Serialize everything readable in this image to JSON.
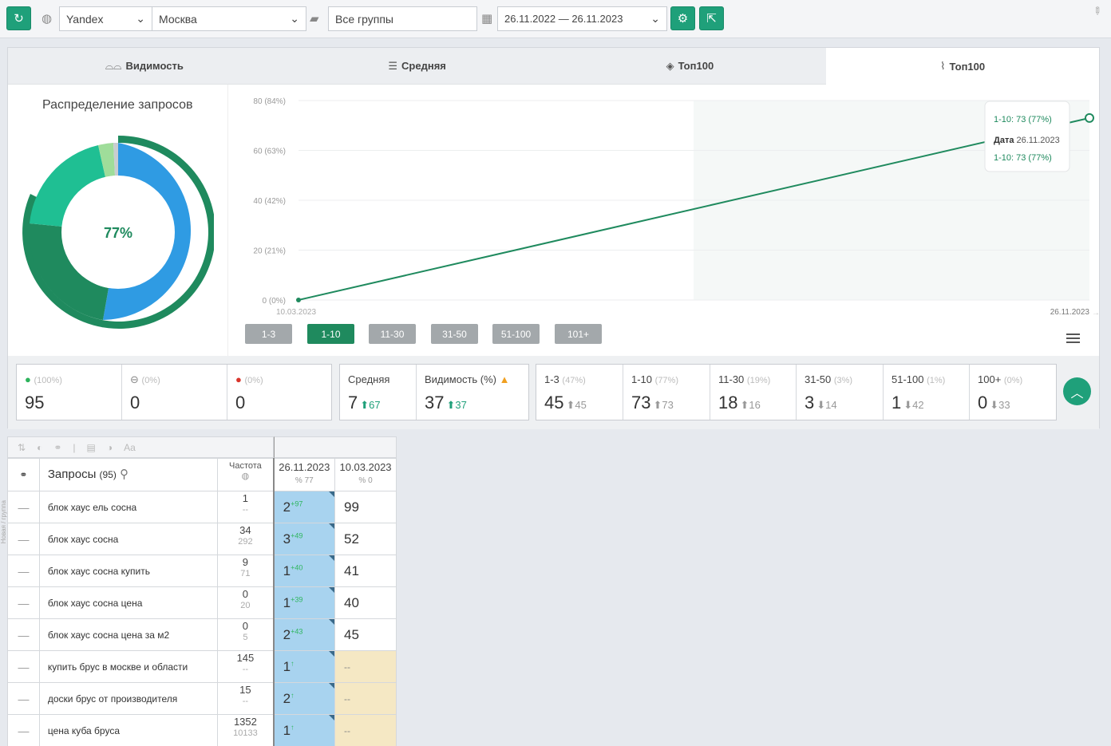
{
  "toolbar": {
    "search_engine": "Yandex",
    "region": "Москва",
    "group": "Все группы",
    "date_range": "26.11.2022 — 26.11.2023"
  },
  "tabs": [
    {
      "icon": "glasses-icon",
      "label": "Видимость"
    },
    {
      "icon": "list-icon",
      "label": "Средняя"
    },
    {
      "icon": "layers-icon",
      "label": "Топ100"
    },
    {
      "icon": "chart-icon",
      "label": "Топ100"
    }
  ],
  "distribution": {
    "title": "Распределение запросов",
    "center_value": "77%"
  },
  "chart_data": {
    "type": "line",
    "y_ticks": [
      "80 (84%)",
      "60 (63%)",
      "40 (42%)",
      "20 (21%)",
      "0 (0%)"
    ],
    "ylim": [
      0,
      80
    ],
    "x_start": "10.03.2023",
    "x_end": "26.11.2023",
    "series": [
      {
        "name": "1-10",
        "values": [
          0,
          73
        ],
        "x": [
          "10.03.2023",
          "26.11.2023"
        ]
      }
    ],
    "tooltip": {
      "line1": "1-10: 73 (77%)",
      "date_label": "Дата",
      "date": "26.11.2023",
      "line2": "1-10: 73 (77%)"
    }
  },
  "range_buttons": [
    "1-3",
    "1-10",
    "11-30",
    "31-50",
    "51-100",
    "101+"
  ],
  "stats": {
    "up": {
      "pct": "(100%)",
      "value": "95"
    },
    "eq": {
      "pct": "(0%)",
      "value": "0"
    },
    "down": {
      "pct": "(0%)",
      "value": "0"
    },
    "avg": {
      "label": "Средняя",
      "value": "7",
      "delta": "67"
    },
    "vis": {
      "label": "Видимость (%)",
      "value": "37",
      "delta": "37"
    },
    "ranges": [
      {
        "label": "1-3",
        "pct": "(47%)",
        "value": "45",
        "delta": "45"
      },
      {
        "label": "1-10",
        "pct": "(77%)",
        "value": "73",
        "delta": "73"
      },
      {
        "label": "11-30",
        "pct": "(19%)",
        "value": "18",
        "delta": "16"
      },
      {
        "label": "31-50",
        "pct": "(3%)",
        "value": "3",
        "delta": "14"
      },
      {
        "label": "51-100",
        "pct": "(1%)",
        "value": "1",
        "delta": "42"
      },
      {
        "label": "100+",
        "pct": "(0%)",
        "value": "0",
        "delta": "33"
      }
    ]
  },
  "table": {
    "side_label": "Новая / группа",
    "header_queries": "Запросы",
    "header_count": "(95)",
    "header_freq": "Частота",
    "date1": "26.11.2023",
    "date1_sub": "77",
    "date2": "10.03.2023",
    "date2_sub": "0",
    "rows": [
      {
        "q": "блок хаус ель сосна",
        "f1": "1",
        "f2": "--",
        "p": "2",
        "d": "97",
        "prev": "99"
      },
      {
        "q": "блок хаус сосна",
        "f1": "34",
        "f2": "292",
        "p": "3",
        "d": "49",
        "prev": "52"
      },
      {
        "q": "блок хаус сосна купить",
        "f1": "9",
        "f2": "71",
        "p": "1",
        "d": "40",
        "prev": "41"
      },
      {
        "q": "блок хаус сосна цена",
        "f1": "0",
        "f2": "20",
        "p": "1",
        "d": "39",
        "prev": "40"
      },
      {
        "q": "блок хаус сосна цена за м2",
        "f1": "0",
        "f2": "5",
        "p": "2",
        "d": "43",
        "prev": "45"
      },
      {
        "q": "купить брус в москве и области",
        "f1": "145",
        "f2": "--",
        "p": "1",
        "d": "↑",
        "prev": "--"
      },
      {
        "q": "доски брус от производителя",
        "f1": "15",
        "f2": "--",
        "p": "2",
        "d": "↑",
        "prev": "--"
      },
      {
        "q": "цена куба бруса",
        "f1": "1352",
        "f2": "10133",
        "p": "1",
        "d": "↑",
        "prev": "--"
      }
    ]
  }
}
